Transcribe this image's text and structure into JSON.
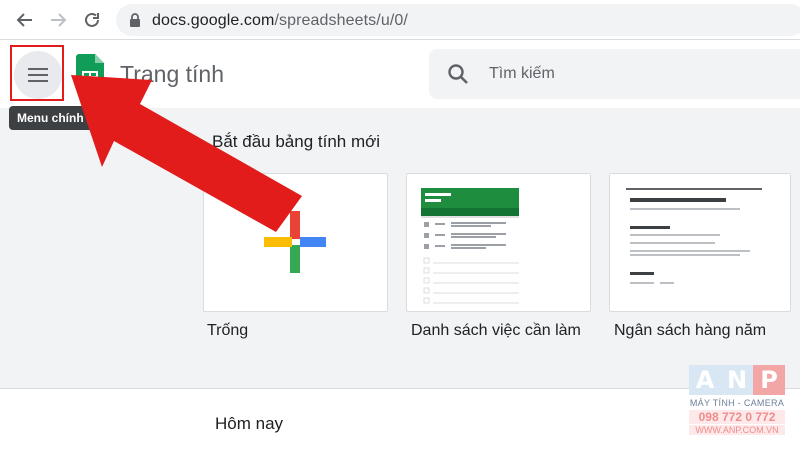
{
  "browser": {
    "url_host": "docs.google.com",
    "url_path": "/spreadsheets/u/0/"
  },
  "header": {
    "title": "Trang tính",
    "search_placeholder": "Tìm kiếm",
    "menu_tooltip": "Menu chính"
  },
  "templates": {
    "heading": "Bắt đầu bảng tính mới",
    "items": [
      {
        "label": "Trống",
        "icon": "plus-icon"
      },
      {
        "label": "Danh sách việc cần làm",
        "icon": "todo-preview"
      },
      {
        "label": "Ngân sách hàng năm",
        "icon": "budget-preview"
      }
    ]
  },
  "recent": {
    "heading": "Hôm nay"
  },
  "watermark": {
    "letters": [
      "A",
      "N",
      "P"
    ],
    "subtitle": "MÁY TÍNH - CAMERA",
    "phone": "098 772 0 772",
    "site": "WWW.ANP.COM.VN"
  },
  "colors": {
    "sheets_green": "#0f9d58",
    "annotation_red": "#e21b1b",
    "section_bg": "#f1f3f4"
  }
}
